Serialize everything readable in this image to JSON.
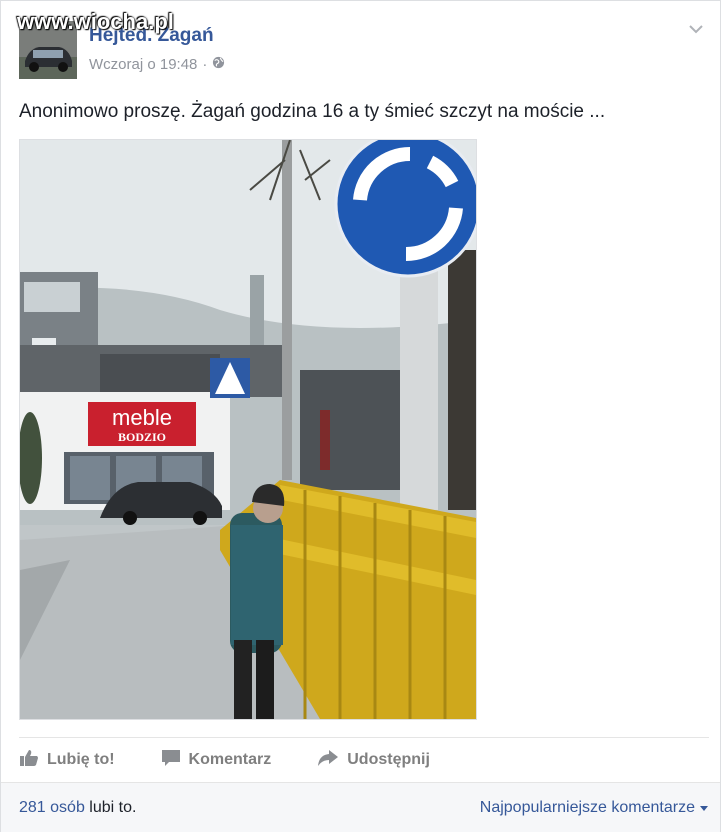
{
  "watermark": "www.wiocha.pl",
  "post": {
    "page_name": "Hejted. Żagań",
    "timestamp": "Wczoraj o 19:48",
    "separator": "·",
    "text": "Anonimowo proszę. Żagań godzina 16 a ty śmieć szczyt na moście ...",
    "photo_sign_text_1": "meble",
    "photo_sign_text_2": "BODZIO"
  },
  "actions": {
    "like": "Lubię to!",
    "comment": "Komentarz",
    "share": "Udostępnij"
  },
  "footer": {
    "likes_count": "281 osób",
    "likes_suffix": " lubi to.",
    "sort_label": "Najpopularniejsze komentarze"
  },
  "colors": {
    "link": "#365899",
    "muted": "#90949c",
    "action_gray": "#7f7f7f"
  },
  "icons": [
    "chevron-down-icon",
    "globe-icon",
    "like-icon",
    "comment-icon",
    "share-icon",
    "caret-down-icon"
  ]
}
